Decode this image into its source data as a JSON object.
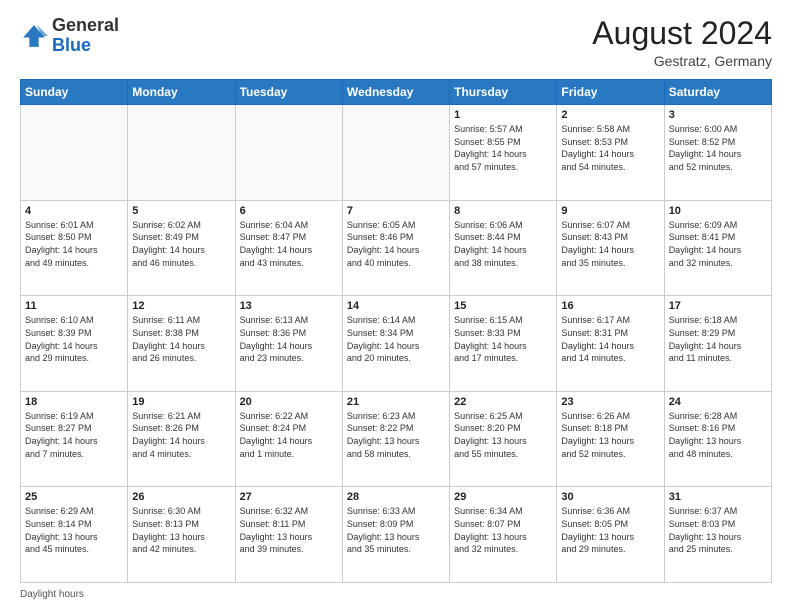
{
  "logo": {
    "general": "General",
    "blue": "Blue"
  },
  "header": {
    "month_year": "August 2024",
    "location": "Gestratz, Germany"
  },
  "days_of_week": [
    "Sunday",
    "Monday",
    "Tuesday",
    "Wednesday",
    "Thursday",
    "Friday",
    "Saturday"
  ],
  "footer": {
    "daylight_label": "Daylight hours"
  },
  "weeks": [
    [
      {
        "day": "",
        "info": ""
      },
      {
        "day": "",
        "info": ""
      },
      {
        "day": "",
        "info": ""
      },
      {
        "day": "",
        "info": ""
      },
      {
        "day": "1",
        "info": "Sunrise: 5:57 AM\nSunset: 8:55 PM\nDaylight: 14 hours\nand 57 minutes."
      },
      {
        "day": "2",
        "info": "Sunrise: 5:58 AM\nSunset: 8:53 PM\nDaylight: 14 hours\nand 54 minutes."
      },
      {
        "day": "3",
        "info": "Sunrise: 6:00 AM\nSunset: 8:52 PM\nDaylight: 14 hours\nand 52 minutes."
      }
    ],
    [
      {
        "day": "4",
        "info": "Sunrise: 6:01 AM\nSunset: 8:50 PM\nDaylight: 14 hours\nand 49 minutes."
      },
      {
        "day": "5",
        "info": "Sunrise: 6:02 AM\nSunset: 8:49 PM\nDaylight: 14 hours\nand 46 minutes."
      },
      {
        "day": "6",
        "info": "Sunrise: 6:04 AM\nSunset: 8:47 PM\nDaylight: 14 hours\nand 43 minutes."
      },
      {
        "day": "7",
        "info": "Sunrise: 6:05 AM\nSunset: 8:46 PM\nDaylight: 14 hours\nand 40 minutes."
      },
      {
        "day": "8",
        "info": "Sunrise: 6:06 AM\nSunset: 8:44 PM\nDaylight: 14 hours\nand 38 minutes."
      },
      {
        "day": "9",
        "info": "Sunrise: 6:07 AM\nSunset: 8:43 PM\nDaylight: 14 hours\nand 35 minutes."
      },
      {
        "day": "10",
        "info": "Sunrise: 6:09 AM\nSunset: 8:41 PM\nDaylight: 14 hours\nand 32 minutes."
      }
    ],
    [
      {
        "day": "11",
        "info": "Sunrise: 6:10 AM\nSunset: 8:39 PM\nDaylight: 14 hours\nand 29 minutes."
      },
      {
        "day": "12",
        "info": "Sunrise: 6:11 AM\nSunset: 8:38 PM\nDaylight: 14 hours\nand 26 minutes."
      },
      {
        "day": "13",
        "info": "Sunrise: 6:13 AM\nSunset: 8:36 PM\nDaylight: 14 hours\nand 23 minutes."
      },
      {
        "day": "14",
        "info": "Sunrise: 6:14 AM\nSunset: 8:34 PM\nDaylight: 14 hours\nand 20 minutes."
      },
      {
        "day": "15",
        "info": "Sunrise: 6:15 AM\nSunset: 8:33 PM\nDaylight: 14 hours\nand 17 minutes."
      },
      {
        "day": "16",
        "info": "Sunrise: 6:17 AM\nSunset: 8:31 PM\nDaylight: 14 hours\nand 14 minutes."
      },
      {
        "day": "17",
        "info": "Sunrise: 6:18 AM\nSunset: 8:29 PM\nDaylight: 14 hours\nand 11 minutes."
      }
    ],
    [
      {
        "day": "18",
        "info": "Sunrise: 6:19 AM\nSunset: 8:27 PM\nDaylight: 14 hours\nand 7 minutes."
      },
      {
        "day": "19",
        "info": "Sunrise: 6:21 AM\nSunset: 8:26 PM\nDaylight: 14 hours\nand 4 minutes."
      },
      {
        "day": "20",
        "info": "Sunrise: 6:22 AM\nSunset: 8:24 PM\nDaylight: 14 hours\nand 1 minute."
      },
      {
        "day": "21",
        "info": "Sunrise: 6:23 AM\nSunset: 8:22 PM\nDaylight: 13 hours\nand 58 minutes."
      },
      {
        "day": "22",
        "info": "Sunrise: 6:25 AM\nSunset: 8:20 PM\nDaylight: 13 hours\nand 55 minutes."
      },
      {
        "day": "23",
        "info": "Sunrise: 6:26 AM\nSunset: 8:18 PM\nDaylight: 13 hours\nand 52 minutes."
      },
      {
        "day": "24",
        "info": "Sunrise: 6:28 AM\nSunset: 8:16 PM\nDaylight: 13 hours\nand 48 minutes."
      }
    ],
    [
      {
        "day": "25",
        "info": "Sunrise: 6:29 AM\nSunset: 8:14 PM\nDaylight: 13 hours\nand 45 minutes."
      },
      {
        "day": "26",
        "info": "Sunrise: 6:30 AM\nSunset: 8:13 PM\nDaylight: 13 hours\nand 42 minutes."
      },
      {
        "day": "27",
        "info": "Sunrise: 6:32 AM\nSunset: 8:11 PM\nDaylight: 13 hours\nand 39 minutes."
      },
      {
        "day": "28",
        "info": "Sunrise: 6:33 AM\nSunset: 8:09 PM\nDaylight: 13 hours\nand 35 minutes."
      },
      {
        "day": "29",
        "info": "Sunrise: 6:34 AM\nSunset: 8:07 PM\nDaylight: 13 hours\nand 32 minutes."
      },
      {
        "day": "30",
        "info": "Sunrise: 6:36 AM\nSunset: 8:05 PM\nDaylight: 13 hours\nand 29 minutes."
      },
      {
        "day": "31",
        "info": "Sunrise: 6:37 AM\nSunset: 8:03 PM\nDaylight: 13 hours\nand 25 minutes."
      }
    ]
  ]
}
